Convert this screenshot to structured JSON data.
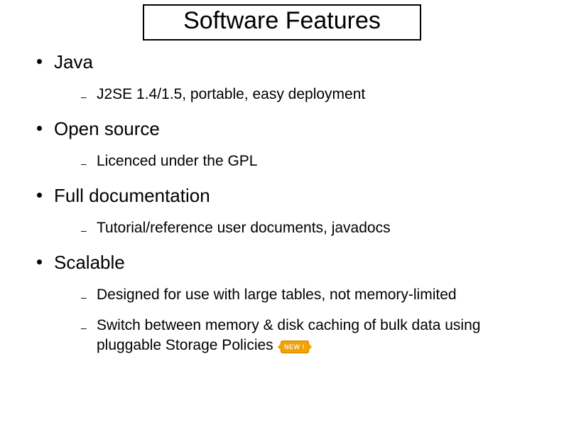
{
  "title": "Software Features",
  "items": [
    {
      "label": "Java",
      "subitems": [
        {
          "text": "J2SE 1.4/1.5, portable, easy deployment",
          "has_new_badge": false
        }
      ]
    },
    {
      "label": "Open source",
      "subitems": [
        {
          "text": "Licenced under the GPL",
          "has_new_badge": false
        }
      ]
    },
    {
      "label": "Full documentation",
      "subitems": [
        {
          "text": "Tutorial/reference user documents, javadocs",
          "has_new_badge": false
        }
      ]
    },
    {
      "label": "Scalable",
      "subitems": [
        {
          "text": "Designed for use with large tables, not memory-limited",
          "has_new_badge": false
        },
        {
          "text": "Switch between memory & disk caching of bulk data using pluggable Storage Policies",
          "has_new_badge": true
        }
      ]
    }
  ],
  "new_badge_text": "NEW !"
}
